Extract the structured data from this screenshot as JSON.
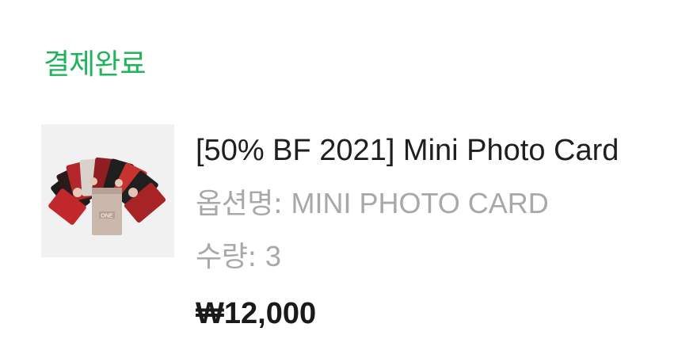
{
  "order": {
    "status": "결제완료",
    "status_color": "#1fb35b"
  },
  "item": {
    "image_icon": "product-photo-card-thumbnail",
    "product_name": "[50% BF 2021] Mini Photo Card",
    "option_label": "옵션명:",
    "option_value": "MINI PHOTO CARD",
    "quantity_label": "수량:",
    "quantity_value": "3",
    "price": "₩12,000",
    "package_text": "ONE"
  }
}
